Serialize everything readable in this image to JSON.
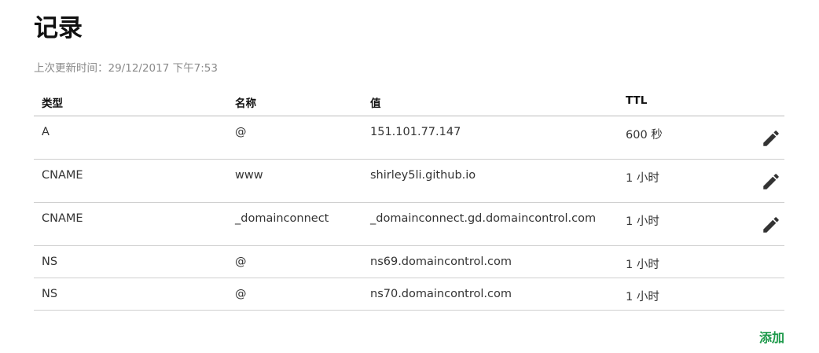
{
  "page": {
    "title": "记录",
    "last_updated": "上次更新时间：29/12/2017 下午7:53"
  },
  "table": {
    "headers": {
      "type": "类型",
      "name": "名称",
      "value": "值",
      "ttl": "TTL"
    },
    "rows": [
      {
        "type": "A",
        "name": "@",
        "value": "151.101.77.147",
        "ttl": "600 秒",
        "editable": true
      },
      {
        "type": "CNAME",
        "name": "www",
        "value": "shirley5li.github.io",
        "ttl": "1 小时",
        "editable": true
      },
      {
        "type": "CNAME",
        "name": "_domainconnect",
        "value": "_domainconnect.gd.domaincontrol.com",
        "ttl": "1 小时",
        "editable": true
      },
      {
        "type": "NS",
        "name": "@",
        "value": "ns69.domaincontrol.com",
        "ttl": "1 小时",
        "editable": false
      },
      {
        "type": "NS",
        "name": "@",
        "value": "ns70.domaincontrol.com",
        "ttl": "1 小时",
        "editable": false
      }
    ]
  },
  "actions": {
    "add_label": "添加"
  },
  "icons": {
    "edit": "pencil-icon"
  },
  "colors": {
    "accent": "#1e9a4b",
    "icon": "#333333",
    "muted_text": "#8a8a8a",
    "divider": "#cfcfcf"
  }
}
